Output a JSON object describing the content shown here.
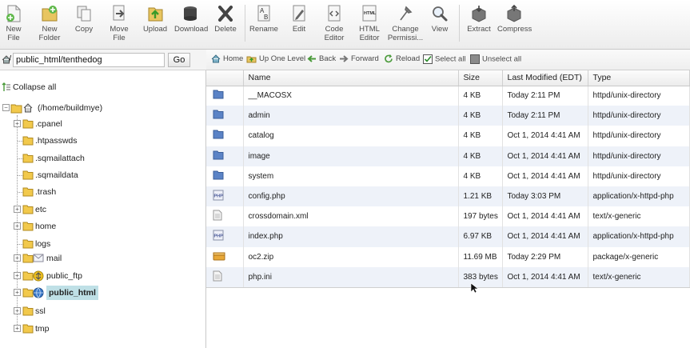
{
  "toolbar": {
    "buttons": [
      {
        "label": "New File",
        "icon": "new-file-icon"
      },
      {
        "label": "New Folder",
        "icon": "new-folder-icon"
      },
      {
        "label": "Copy",
        "icon": "copy-icon"
      },
      {
        "label": "Move File",
        "icon": "move-file-icon"
      },
      {
        "label": "Upload",
        "icon": "upload-icon"
      },
      {
        "label": "Download",
        "icon": "download-icon"
      },
      {
        "label": "Delete",
        "icon": "delete-icon"
      },
      {
        "label": "Rename",
        "icon": "rename-icon"
      },
      {
        "label": "Edit",
        "icon": "edit-icon"
      },
      {
        "label": "Code Editor",
        "icon": "code-editor-icon"
      },
      {
        "label": "HTML Editor",
        "icon": "html-editor-icon"
      },
      {
        "label": "Change Permissi...",
        "icon": "change-permissions-icon"
      },
      {
        "label": "View",
        "icon": "view-icon"
      },
      {
        "label": "Extract",
        "icon": "extract-icon"
      },
      {
        "label": "Compress",
        "icon": "compress-icon"
      }
    ],
    "new_folder_line1": "New",
    "new_folder_line2": "Folder",
    "code_editor_line1": "Code",
    "code_editor_line2": "Editor",
    "html_editor_line1": "HTML",
    "html_editor_line2": "Editor",
    "change_perm_line1": "Change",
    "change_perm_line2": "Permissi..."
  },
  "pathbar": {
    "path_value": "public_html/tenthedog",
    "path_prefix": "/",
    "go_label": "Go"
  },
  "navbar": {
    "home": "Home",
    "up_one_level": "Up One Level",
    "back": "Back",
    "forward": "Forward",
    "reload": "Reload",
    "select_all": "Select all",
    "unselect_all": "Unselect all"
  },
  "sidebar": {
    "collapse_all": "Collapse all",
    "root": "(/home/buildmye)",
    "items": [
      {
        "label": ".cpanel",
        "expandable": true
      },
      {
        "label": ".htpasswds",
        "expandable": false
      },
      {
        "label": ".sqmailattach",
        "expandable": false
      },
      {
        "label": ".sqmaildata",
        "expandable": false
      },
      {
        "label": ".trash",
        "expandable": false
      },
      {
        "label": "etc",
        "expandable": true
      },
      {
        "label": "home",
        "expandable": true
      },
      {
        "label": "logs",
        "expandable": false
      },
      {
        "label": "mail",
        "expandable": true
      },
      {
        "label": "public_ftp",
        "expandable": true
      },
      {
        "label": "public_html",
        "expandable": true,
        "selected": true
      },
      {
        "label": "ssl",
        "expandable": true
      },
      {
        "label": "tmp",
        "expandable": true
      }
    ]
  },
  "table": {
    "columns": [
      "Name",
      "Size",
      "Last Modified (EDT)",
      "Type"
    ],
    "rows": [
      {
        "icon": "folder-icon",
        "name": "__MACOSX",
        "size": "4 KB",
        "modified": "Today 2:11 PM",
        "type": "httpd/unix-directory"
      },
      {
        "icon": "folder-icon",
        "name": "admin",
        "size": "4 KB",
        "modified": "Today 2:11 PM",
        "type": "httpd/unix-directory"
      },
      {
        "icon": "folder-icon",
        "name": "catalog",
        "size": "4 KB",
        "modified": "Oct 1, 2014 4:41 AM",
        "type": "httpd/unix-directory"
      },
      {
        "icon": "folder-icon",
        "name": "image",
        "size": "4 KB",
        "modified": "Oct 1, 2014 4:41 AM",
        "type": "httpd/unix-directory"
      },
      {
        "icon": "folder-icon",
        "name": "system",
        "size": "4 KB",
        "modified": "Oct 1, 2014 4:41 AM",
        "type": "httpd/unix-directory"
      },
      {
        "icon": "php-file-icon",
        "name": "config.php",
        "size": "1.21 KB",
        "modified": "Today 3:03 PM",
        "type": "application/x-httpd-php"
      },
      {
        "icon": "generic-file-icon",
        "name": "crossdomain.xml",
        "size": "197 bytes",
        "modified": "Oct 1, 2014 4:41 AM",
        "type": "text/x-generic"
      },
      {
        "icon": "php-file-icon",
        "name": "index.php",
        "size": "6.97 KB",
        "modified": "Oct 1, 2014 4:41 AM",
        "type": "application/x-httpd-php"
      },
      {
        "icon": "zip-file-icon",
        "name": "oc2.zip",
        "size": "11.69 MB",
        "modified": "Today 2:29 PM",
        "type": "package/x-generic"
      },
      {
        "icon": "generic-file-icon",
        "name": "php.ini",
        "size": "383 bytes",
        "modified": "Oct 1, 2014 4:41 AM",
        "type": "text/x-generic"
      }
    ]
  },
  "colors": {
    "selection": "#bfe0e6",
    "row_alt": "#eef2f9",
    "folder_blue": "#5b83c6",
    "folder_yellow": "#f2c94c"
  }
}
